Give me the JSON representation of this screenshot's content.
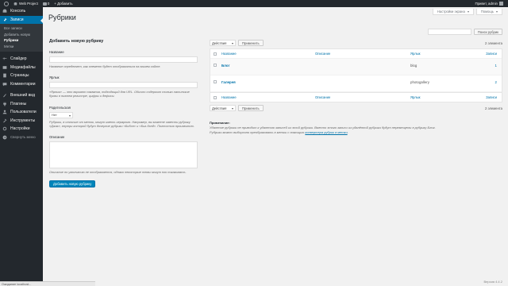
{
  "adminbar": {
    "site_name": "Web Project",
    "comments_count": "0",
    "add_label": "+ Добавить",
    "greeting": "Привет, admin"
  },
  "sidebar": {
    "items": [
      {
        "label": "Консоль",
        "icon": "dashboard-icon"
      },
      {
        "label": "Записи",
        "icon": "pin-icon"
      },
      {
        "label": "Слайдер",
        "icon": "slider-icon"
      },
      {
        "label": "Медиафайлы",
        "icon": "media-icon"
      },
      {
        "label": "Страницы",
        "icon": "pages-icon"
      },
      {
        "label": "Комментарии",
        "icon": "comments-icon"
      },
      {
        "label": "Внешний вид",
        "icon": "appearance-icon"
      },
      {
        "label": "Плагины",
        "icon": "plugins-icon"
      },
      {
        "label": "Пользователи",
        "icon": "users-icon"
      },
      {
        "label": "Инструменты",
        "icon": "tools-icon"
      },
      {
        "label": "Настройки",
        "icon": "settings-icon"
      },
      {
        "label": "Свернуть меню",
        "icon": "collapse-icon"
      }
    ],
    "submenu": [
      "Все записи",
      "Добавить новую",
      "Рубрики",
      "Метки"
    ]
  },
  "screen_meta": {
    "options": "Настройки экрана",
    "help": "Помощь"
  },
  "page_title": "Рубрики",
  "search": {
    "button": "Поиск рубрик"
  },
  "form": {
    "heading": "Добавить новую рубрику",
    "name_label": "Название",
    "name_desc": "Название определяет, как элемент будет отображаться на вашем сайте.",
    "slug_label": "Ярлык",
    "slug_desc": "«Ярлык» — это вариант названия, подходящий для URL. Обычно содержит только латинские буквы в нижнем регистре, цифры и дефисы.",
    "parent_label": "Родительская",
    "parent_value": "Нет",
    "parent_desc": "Рубрики, в отличие от меток, могут иметь иерархию. Например, вы можете завести рубрику «Джаз», внутри которой будут дочерние рубрики «Бибоп» и «Биг-бэнд». Полностью произвольно.",
    "description_label": "Описание",
    "description_desc": "Описание по умолчанию не отображается, однако некоторые темы могут его показывать.",
    "submit": "Добавить новую рубрику"
  },
  "table": {
    "bulk_label": "Действия",
    "apply": "Применить",
    "count": "2 элемента",
    "columns": {
      "name": "Название",
      "description": "Описание",
      "slug": "Ярлык",
      "count": "Записи"
    },
    "rows": [
      {
        "name": "Блог",
        "description": "",
        "slug": "blog",
        "count": "1"
      },
      {
        "name": "Галерея",
        "description": "",
        "slug": "photogallery",
        "count": "2"
      }
    ]
  },
  "notes": {
    "heading": "Примечание:",
    "line1": "Удаление рубрики не приводит к удалению записей из этой рубрики. Вместо этого записи из удалённой рубрики будут перемещены в рубрику Блог.",
    "line2": "Рубрики можно выборочно преобразовать в метки с помощью ",
    "link": "конвертера рубрик в метки",
    "line2_end": "."
  },
  "footer": {
    "version": "Версия 4.4.2"
  },
  "status_bar": "Ожидание localhost..."
}
